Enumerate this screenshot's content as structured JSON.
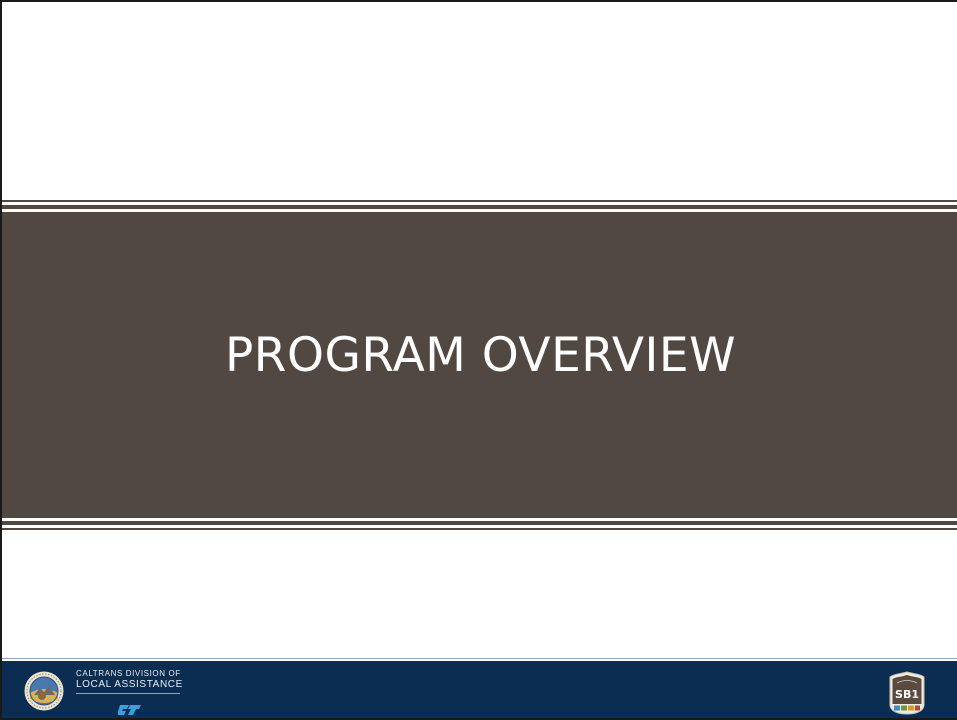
{
  "slide": {
    "title": "PROGRAM OVERVIEW"
  },
  "footer": {
    "division_line1": "CALTRANS DIVISION OF",
    "division_line2": "LOCAL ASSISTANCE",
    "seal_icon": "california-seal-icon",
    "caltrans_logo": "caltrans-logo-icon",
    "sb1_logo": "sb1-shield-icon",
    "sb1_text": "SB1"
  },
  "colors": {
    "banner": "#514842",
    "footer": "#0c2d52",
    "title_text": "#ffffff"
  }
}
